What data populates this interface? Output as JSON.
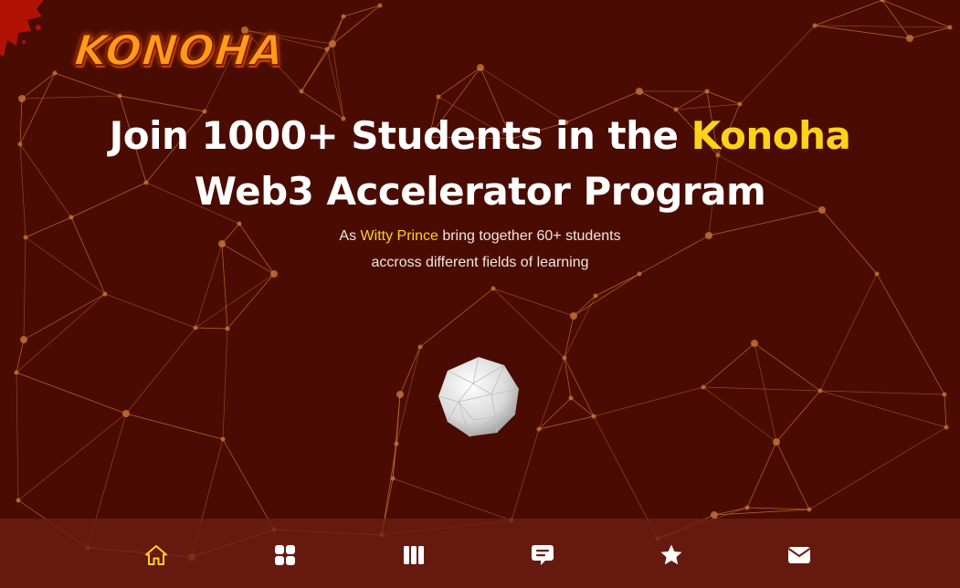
{
  "brand": {
    "logo_text": "KONOHA"
  },
  "hero": {
    "title_line1_prefix": "Join 1000+ Students in the ",
    "title_line1_highlight": "Konoha",
    "title_line2": "Web3 Accelerator Program",
    "subtitle_prefix": "As ",
    "subtitle_highlight": "Witty Prince",
    "subtitle_suffix": " bring together 60+ students",
    "subtitle_line2": "accross different fields of learning"
  },
  "nav": {
    "items": [
      {
        "icon": "home-icon",
        "active": true
      },
      {
        "icon": "grid-icon",
        "active": false
      },
      {
        "icon": "columns-icon",
        "active": false
      },
      {
        "icon": "comment-icon",
        "active": false
      },
      {
        "icon": "star-icon",
        "active": false
      },
      {
        "icon": "envelope-icon",
        "active": false
      }
    ]
  },
  "colors": {
    "background": "#4a0c02",
    "accent": "#ffd21a",
    "network": "#c8743a",
    "navbar": "#6e1e12"
  }
}
